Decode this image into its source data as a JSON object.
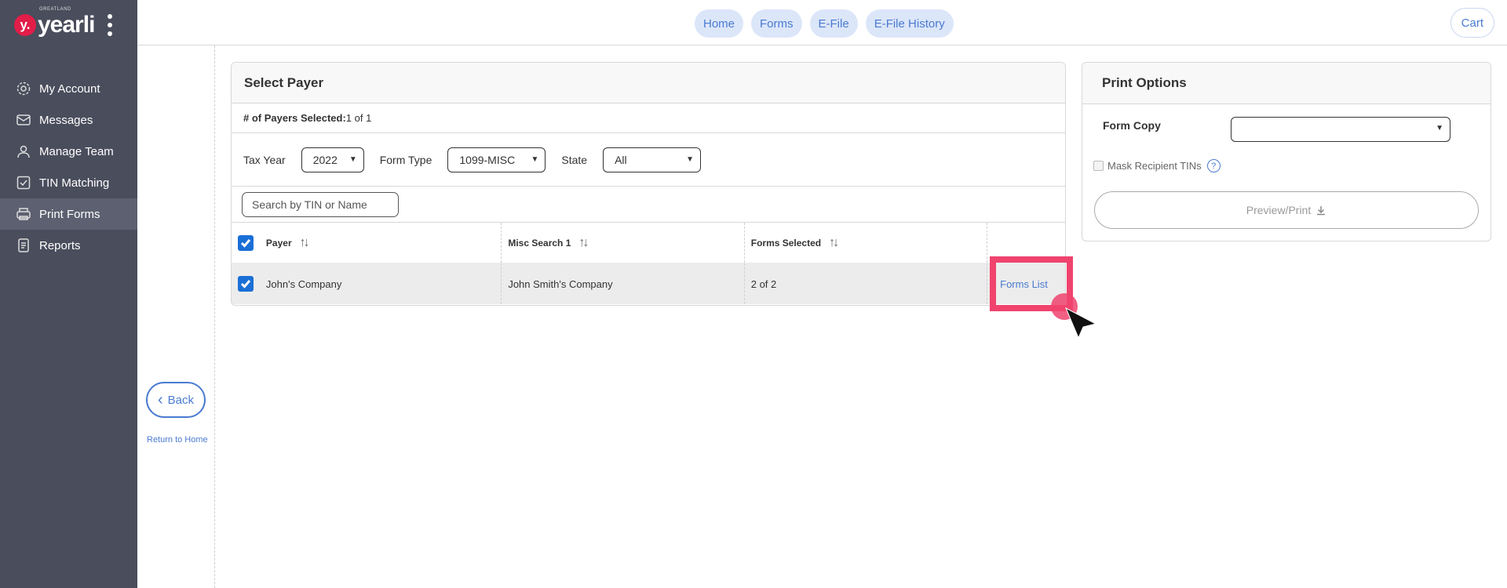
{
  "brand": {
    "name": "yearli",
    "sub": "GREATLAND",
    "mark": "y."
  },
  "sidebar": {
    "items": [
      {
        "label": "My Account",
        "icon": "gear-icon"
      },
      {
        "label": "Messages",
        "icon": "envelope-icon"
      },
      {
        "label": "Manage Team",
        "icon": "user-icon"
      },
      {
        "label": "TIN Matching",
        "icon": "check-square-icon"
      },
      {
        "label": "Print Forms",
        "icon": "printer-icon",
        "active": true
      },
      {
        "label": "Reports",
        "icon": "document-icon"
      }
    ]
  },
  "topnav": {
    "home": "Home",
    "forms": "Forms",
    "efile": "E-File",
    "efile_history": "E-File History",
    "cart": "Cart"
  },
  "left": {
    "back": "Back",
    "return_home": "Return to Home"
  },
  "payer_panel": {
    "title": "Select Payer",
    "count_label": "# of Payers Selected:",
    "count_value": "1 of 1",
    "filters": {
      "tax_year_label": "Tax Year",
      "tax_year_value": "2022",
      "form_type_label": "Form Type",
      "form_type_value": "1099-MISC",
      "state_label": "State",
      "state_value": "All"
    },
    "search_placeholder": "Search by TIN or Name",
    "columns": {
      "payer": "Payer",
      "misc": "Misc Search 1",
      "forms": "Forms Selected"
    },
    "rows": [
      {
        "payer": "John's Company",
        "misc": "John Smith's Company",
        "forms": "2 of 2",
        "action": "Forms List"
      }
    ]
  },
  "print_panel": {
    "title": "Print Options",
    "form_copy_label": "Form Copy",
    "form_copy_value": "",
    "mask_label": "Mask Recipient TINs",
    "help": "?",
    "preview_label": "Preview/Print"
  },
  "colors": {
    "sidebar": "#4a4d5c",
    "accent": "#4a7bd0",
    "checkbox": "#1a6fd6",
    "highlight": "#f0436e",
    "brand": "#e11d48"
  }
}
